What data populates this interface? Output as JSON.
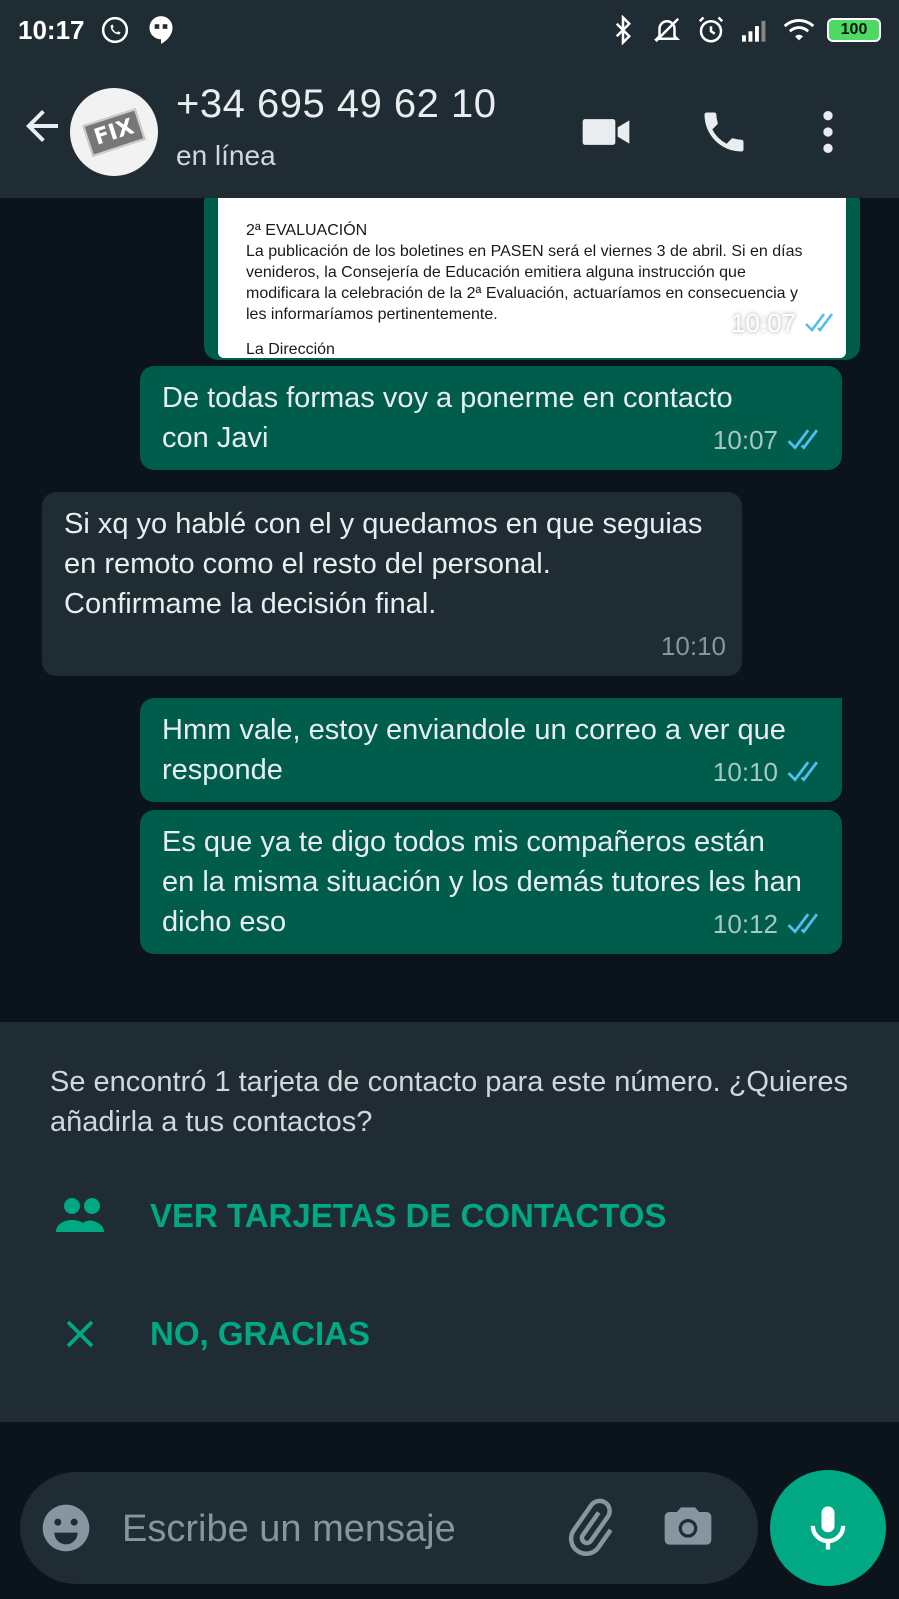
{
  "status_bar": {
    "time": "10:17",
    "battery": "100",
    "icons": [
      "whatsapp-icon",
      "hangouts-icon",
      "bluetooth-icon",
      "mute-icon",
      "alarm-icon",
      "signal-icon",
      "wifi-icon",
      "battery-icon"
    ]
  },
  "header": {
    "contact_name": "+34 695 49 62 10",
    "contact_status": "en línea",
    "avatar_text": "FIX",
    "icons": [
      "back-arrow-icon",
      "video-call-icon",
      "phone-icon",
      "more-vert-icon"
    ]
  },
  "messages": [
    {
      "direction": "out",
      "type": "image",
      "doc": {
        "title": "2ª EVALUACIÓN",
        "body": "La publicación de los boletines en PASEN será el viernes 3 de abril. Si en días venideros, la Consejería de Educación emitiera alguna instrucción que modificara la celebración de la 2ª Evaluación, actuaríamos en consecuencia y les informaríamos pertinentemente.",
        "sign": "La Dirección"
      },
      "time": "10:07",
      "status": "read"
    },
    {
      "direction": "out",
      "text": "De todas formas voy a ponerme en contacto con Javi",
      "time": "10:07",
      "status": "read"
    },
    {
      "direction": "in",
      "text": "Si xq yo hablé con el y quedamos en que seguias en remoto como el resto del personal. Confirmame la decisión final.",
      "time": "10:10"
    },
    {
      "direction": "out",
      "text": "Hmm vale, estoy enviandole un correo a ver que responde",
      "time": "10:10",
      "status": "read"
    },
    {
      "direction": "out",
      "text": "Es que ya te digo todos mis compañeros están en la misma situación y los demás tutores les han dicho eso",
      "time": "10:12",
      "status": "read"
    }
  ],
  "contact_prompt": {
    "text": "Se encontró 1 tarjeta de contacto para este número. ¿Quieres añadirla a tus contactos?",
    "view_label": "VER TARJETAS DE CONTACTOS",
    "dismiss_label": "NO, GRACIAS"
  },
  "input_bar": {
    "placeholder": "Escribe un mensaje"
  },
  "colors": {
    "bar": "#1f2c34",
    "chat_bg": "#0b141a",
    "outgoing_bubble": "#005c4b",
    "incoming_bubble": "#1f2c34",
    "accent": "#00a884",
    "read_ticks": "#53bdeb"
  }
}
